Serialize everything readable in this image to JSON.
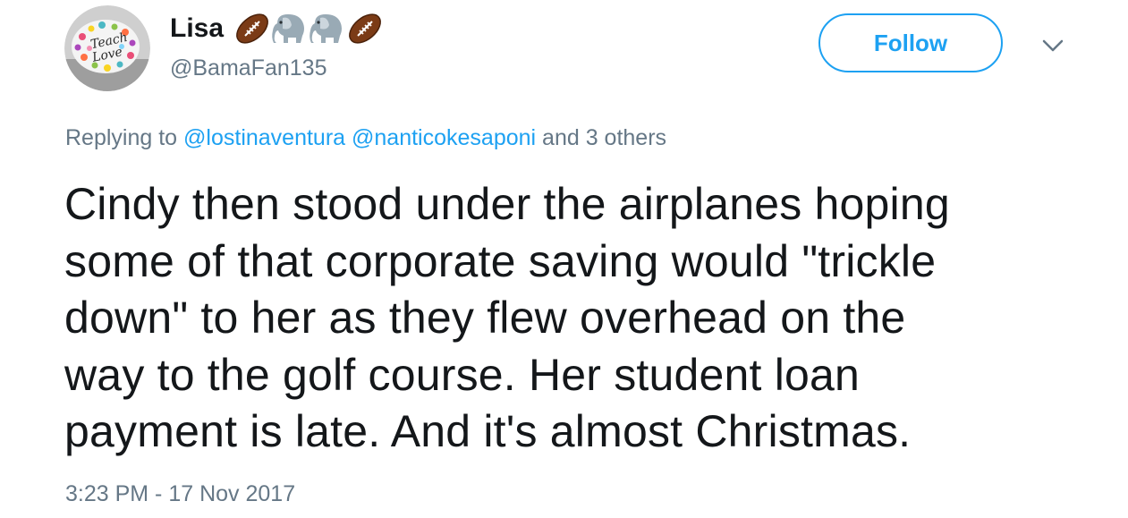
{
  "user": {
    "display_name": "Lisa",
    "handle": "@BamaFan135",
    "avatar_text": "Teach Love",
    "name_emojis": [
      "american-football-icon",
      "elephant-icon",
      "elephant-icon",
      "american-football-icon"
    ]
  },
  "follow_button": {
    "label": "Follow"
  },
  "reply": {
    "prefix": "Replying to",
    "mentions": [
      "@lostinaventura",
      "@nanticokesaponi"
    ],
    "suffix": "and 3 others"
  },
  "tweet": {
    "text": "Cindy then stood under the airplanes hoping\nsome of that corporate saving would \"trickle\ndown\" to her as they flew overhead on the\nway to the golf course. Her student loan\npayment is late. And it's almost Christmas.",
    "timestamp": "3:23 PM - 17 Nov 2017"
  },
  "colors": {
    "accent": "#1da1f2",
    "text": "#14171a",
    "muted": "#657786"
  }
}
